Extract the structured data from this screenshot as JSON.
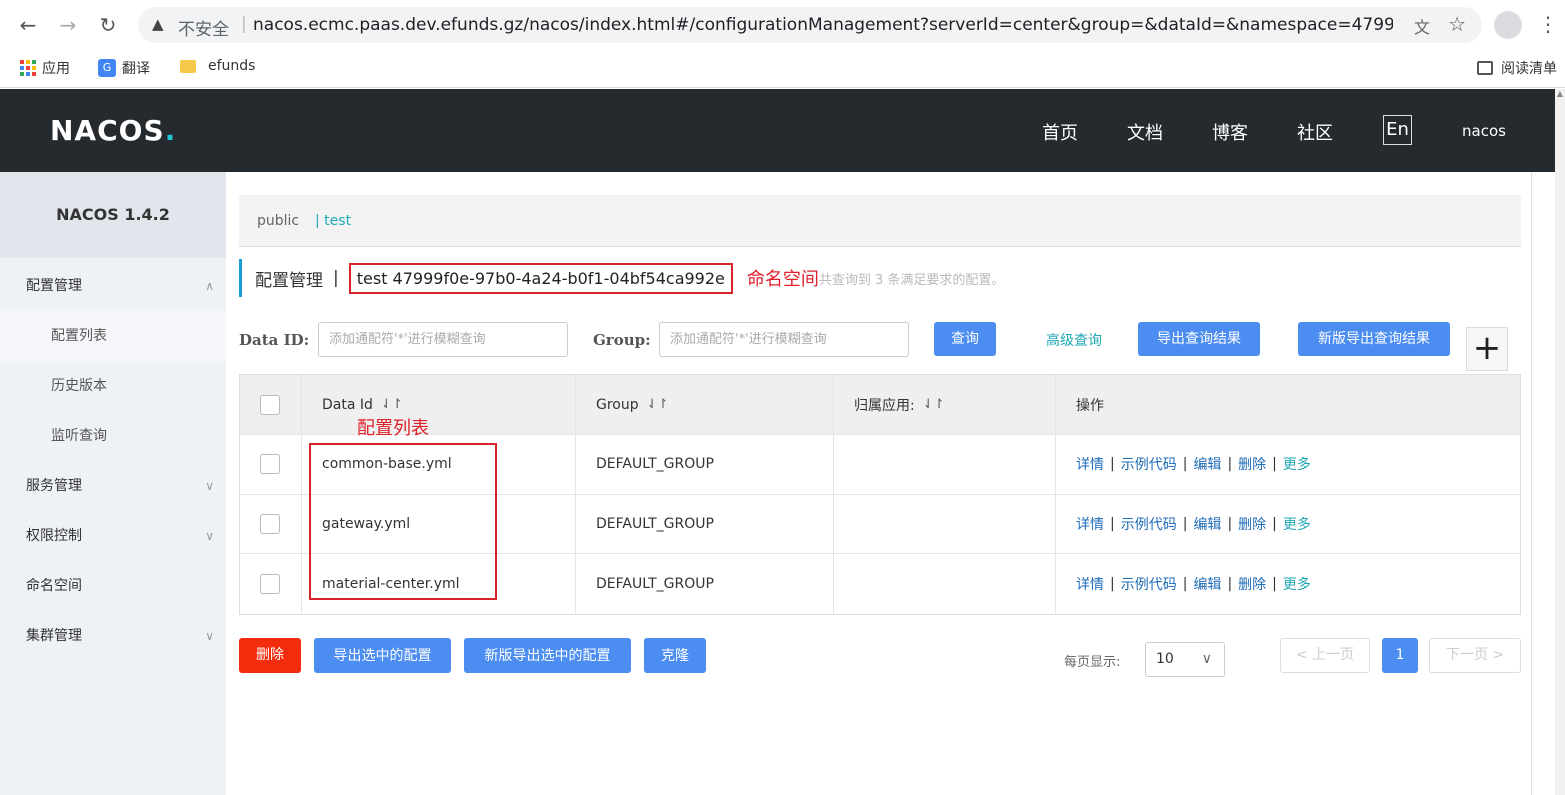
{
  "browser": {
    "insecure_label": "不安全",
    "url": "nacos.ecmc.paas.dev.efunds.gz/nacos/index.html#/configurationManagement?serverId=center&group=&dataId=&namespace=4799...",
    "bookmarks": [
      {
        "label": "应用"
      },
      {
        "label": "翻译"
      },
      {
        "label": "efunds"
      }
    ],
    "reading_list": "阅读清单"
  },
  "header": {
    "logo_text": "NACOS",
    "logo_dot": ".",
    "nav": [
      "首页",
      "文档",
      "博客",
      "社区"
    ],
    "lang": "En",
    "user": "nacos"
  },
  "sidebar": {
    "title": "NACOS 1.4.2",
    "items": [
      {
        "label": "配置管理"
      },
      {
        "label": "配置列表"
      },
      {
        "label": "历史版本"
      },
      {
        "label": "监听查询"
      },
      {
        "label": "服务管理"
      },
      {
        "label": "权限控制"
      },
      {
        "label": "命名空间"
      },
      {
        "label": "集群管理"
      }
    ]
  },
  "namespaces": {
    "items": [
      "public",
      "| test"
    ]
  },
  "heading": {
    "title": "配置管理",
    "pipe": "|",
    "namespace": "test  47999f0e-97b0-4a24-b0f1-04bf54ca992e",
    "annotation": "命名空间",
    "found": "共查询到 3 条满足要求的配置。"
  },
  "search": {
    "dataid_label": "Data ID:",
    "dataid_placeholder": "添加通配符'*'进行模糊查询",
    "group_label": "Group:",
    "group_placeholder": "添加通配符'*'进行模糊查询",
    "query": "查询",
    "advanced": "高级查询",
    "export": "导出查询结果",
    "new_export": "新版导出查询结果",
    "add": "+"
  },
  "table": {
    "headers": [
      "Data Id",
      "Group",
      "归属应用:",
      "操作"
    ],
    "sort_icon": "⇃↾",
    "annotation": "配置列表",
    "rows": [
      {
        "data_id": "common-base.yml",
        "group": "DEFAULT_GROUP",
        "app": ""
      },
      {
        "data_id": "gateway.yml",
        "group": "DEFAULT_GROUP",
        "app": ""
      },
      {
        "data_id": "material-center.yml",
        "group": "DEFAULT_GROUP",
        "app": ""
      }
    ],
    "ops": [
      "详情",
      "示例代码",
      "编辑",
      "删除",
      "更多"
    ]
  },
  "footer": {
    "delete": "删除",
    "export_selected": "导出选中的配置",
    "new_export_selected": "新版导出选中的配置",
    "clone": "克隆",
    "page_size_label": "每页显示:",
    "page_size": "10",
    "prev": "上一页",
    "page": "1",
    "next": "下一页"
  },
  "colors": {
    "header_bg": "#252a2f",
    "primary": "#4b8df0",
    "danger": "#f42c0e",
    "annotation": "#e0202a",
    "link": "#1e6bb8",
    "teal": "#21a8b6"
  }
}
